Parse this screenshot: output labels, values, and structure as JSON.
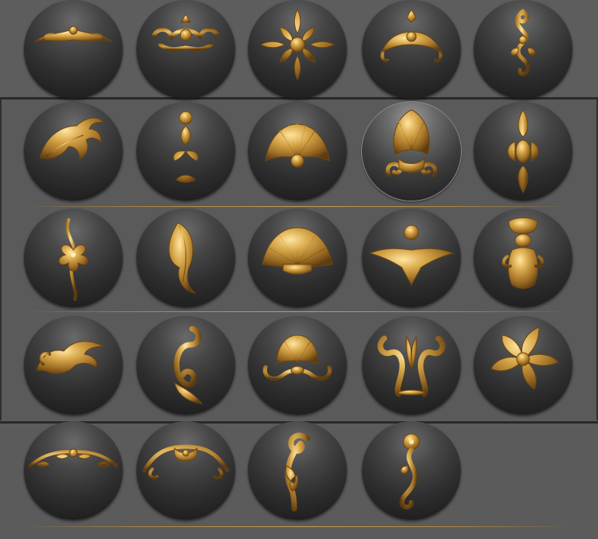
{
  "palette": {
    "title": "",
    "accent_color": "#c49c4e",
    "ball_color": "#303030",
    "selected_index": 8
  },
  "rows": [
    {
      "items": [
        {
          "name": "ornament-garland-wide",
          "icon": "swag-ornament-icon"
        },
        {
          "name": "ornament-scroll-frame",
          "icon": "scroll-frame-icon"
        },
        {
          "name": "ornament-acanthus-cross",
          "icon": "acanthus-cross-icon"
        },
        {
          "name": "ornament-crest-drape",
          "icon": "crest-drape-icon"
        },
        {
          "name": "ornament-vertical-scroll",
          "icon": "vertical-scroll-icon"
        }
      ]
    },
    {
      "items": [
        {
          "name": "ornament-acanthus-leaf",
          "icon": "acanthus-leaf-icon"
        },
        {
          "name": "ornament-floral-stem",
          "icon": "floral-stem-icon"
        },
        {
          "name": "ornament-shell-fan",
          "icon": "shell-fan-icon"
        },
        {
          "name": "ornament-palmette",
          "icon": "palmette-icon"
        },
        {
          "name": "ornament-vertical-rosette",
          "icon": "vertical-rosette-icon"
        }
      ]
    },
    {
      "items": [
        {
          "name": "ornament-flower-vine",
          "icon": "flower-vine-icon"
        },
        {
          "name": "ornament-feather-leaf",
          "icon": "feather-leaf-icon"
        },
        {
          "name": "ornament-scallop-shell",
          "icon": "scallop-shell-icon"
        },
        {
          "name": "ornament-winged-boss",
          "icon": "winged-boss-icon"
        },
        {
          "name": "ornament-baroque-panel",
          "icon": "baroque-panel-icon"
        }
      ]
    },
    {
      "items": [
        {
          "name": "ornament-corner-leaf",
          "icon": "corner-leaf-icon"
        },
        {
          "name": "ornament-s-scroll",
          "icon": "s-scroll-icon"
        },
        {
          "name": "ornament-shell-cartouche",
          "icon": "shell-cartouche-icon"
        },
        {
          "name": "ornament-lyre-scroll",
          "icon": "lyre-scroll-icon"
        },
        {
          "name": "ornament-five-petal-flower",
          "icon": "five-petal-flower-icon"
        }
      ]
    },
    {
      "items": [
        {
          "name": "ornament-lace-swag",
          "icon": "lace-swag-icon"
        },
        {
          "name": "ornament-bow-swag",
          "icon": "bow-swag-icon"
        },
        {
          "name": "ornament-curl-scroll",
          "icon": "curl-scroll-icon"
        },
        {
          "name": "ornament-rosette-scroll",
          "icon": "rosette-scroll-icon"
        }
      ]
    }
  ]
}
